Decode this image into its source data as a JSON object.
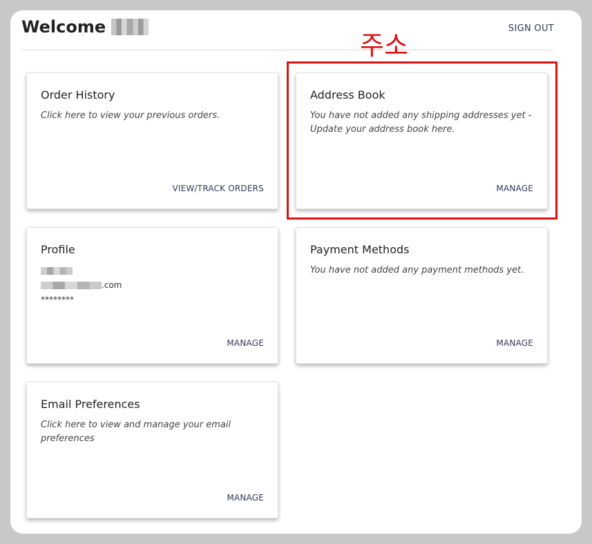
{
  "header": {
    "welcome_label": "Welcome",
    "signout_label": "SIGN OUT"
  },
  "annotation": {
    "korean_label": "주소",
    "color": "#e01010"
  },
  "cards": {
    "order_history": {
      "title": "Order History",
      "description": "Click here to view your previous orders.",
      "action": "VIEW/TRACK ORDERS"
    },
    "address_book": {
      "title": "Address Book",
      "description": "You have not added any shipping addresses yet - Update your address book here.",
      "action": "MANAGE"
    },
    "profile": {
      "title": "Profile",
      "email_suffix": ".com",
      "password_mask": "********",
      "action": "MANAGE"
    },
    "payment_methods": {
      "title": "Payment Methods",
      "description": "You have not added any payment methods yet.",
      "action": "MANAGE"
    },
    "email_preferences": {
      "title": "Email Preferences",
      "description": "Click here to view and manage your email preferences",
      "action": "MANAGE"
    }
  },
  "colors": {
    "link": "#2f3a5a",
    "background": "#c8c8c8",
    "panel": "#ffffff"
  }
}
